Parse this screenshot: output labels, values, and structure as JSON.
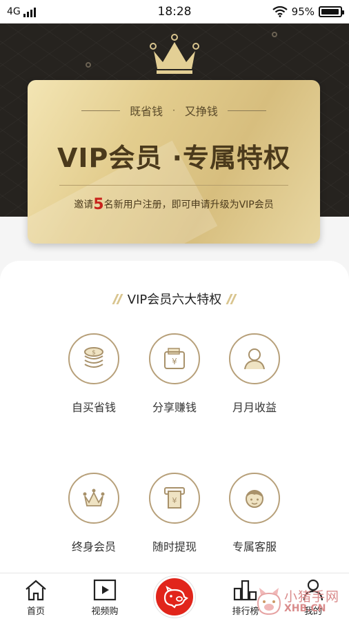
{
  "status_bar": {
    "network": "4G",
    "time": "18:28",
    "battery": "95%",
    "battery_level": 0.95
  },
  "hero": {
    "subtitle_left": "既省钱",
    "subtitle_sep": "·",
    "subtitle_right": "又挣钱",
    "title": "VIP会员 ·专属特权",
    "invite_prefix": "邀请",
    "invite_count": "5",
    "invite_suffix": "名新用户注册，即可申请升级为VIP会员"
  },
  "privileges": {
    "title": "VIP会员六大特权",
    "items": [
      {
        "label": "自买省钱",
        "icon": "coins-icon"
      },
      {
        "label": "分享赚钱",
        "icon": "wallet-yuan-icon"
      },
      {
        "label": "月月收益",
        "icon": "user-avatar-icon"
      },
      {
        "label": "终身会员",
        "icon": "crown-icon"
      },
      {
        "label": "随时提现",
        "icon": "cash-withdraw-icon"
      },
      {
        "label": "专属客服",
        "icon": "service-agent-icon"
      }
    ]
  },
  "tabbar": {
    "items": [
      {
        "label": "首页",
        "icon": "home-icon"
      },
      {
        "label": "视频购",
        "icon": "video-play-icon"
      },
      {
        "label": "",
        "icon": "pig-logo-icon"
      },
      {
        "label": "排行榜",
        "icon": "ranking-bars-icon"
      },
      {
        "label": "我的",
        "icon": "profile-icon"
      }
    ]
  },
  "watermark": {
    "line1": "小猪手网",
    "line2": "XHB.CN"
  },
  "colors": {
    "gold": "#d7be7e",
    "dark": "#26231f",
    "accent_red": "#e1251b",
    "icon_gold": "#b7a07a"
  }
}
